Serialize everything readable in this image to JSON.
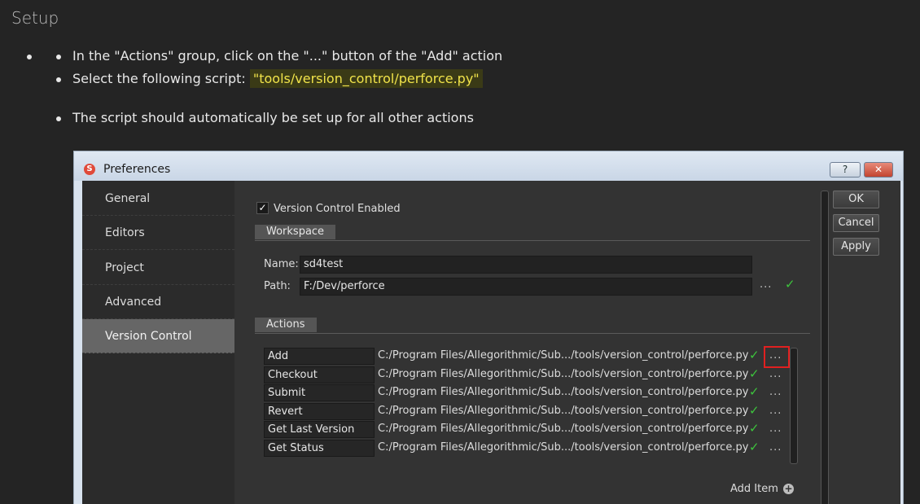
{
  "doc": {
    "title": "Setup",
    "bullets": [
      "In the \"Actions\" group, click on the \"...\" button of the \"Add\" action",
      "Select the following script: ",
      "The script should automatically be set up for all other actions"
    ],
    "script_path": "\"tools/version_control/perforce.py\""
  },
  "dialog": {
    "title": "Preferences",
    "help_label": "?",
    "close_label": "✕",
    "sidebar": [
      "General",
      "Editors",
      "Project",
      "Advanced",
      "Version Control"
    ],
    "active_sidebar": "Version Control",
    "checkbox_label": "Version Control Enabled",
    "workspace": {
      "section": "Workspace",
      "name_label": "Name:",
      "name_value": "sd4test",
      "path_label": "Path:",
      "path_value": "F:/Dev/perforce"
    },
    "actions": {
      "section": "Actions",
      "rows": [
        {
          "name": "Add",
          "path": "C:/Program Files/Allegorithmic/Sub.../tools/version_control/perforce.py"
        },
        {
          "name": "Checkout",
          "path": "C:/Program Files/Allegorithmic/Sub.../tools/version_control/perforce.py"
        },
        {
          "name": "Submit",
          "path": "C:/Program Files/Allegorithmic/Sub.../tools/version_control/perforce.py"
        },
        {
          "name": "Revert",
          "path": "C:/Program Files/Allegorithmic/Sub.../tools/version_control/perforce.py"
        },
        {
          "name": "Get Last Version",
          "path": "C:/Program Files/Allegorithmic/Sub.../tools/version_control/perforce.py"
        },
        {
          "name": "Get Status",
          "path": "C:/Program Files/Allegorithmic/Sub.../tools/version_control/perforce.py"
        }
      ],
      "dots_label": "...",
      "add_item_label": "Add Item"
    },
    "buttons": {
      "ok": "OK",
      "cancel": "Cancel",
      "apply": "Apply"
    },
    "colors": {
      "check": "#3dc43d",
      "highlight_box": "#e02020",
      "script_text": "#f0e34a"
    },
    "icons": {
      "check": "check-icon",
      "add": "plus-icon",
      "app": "substance-logo-icon"
    }
  }
}
